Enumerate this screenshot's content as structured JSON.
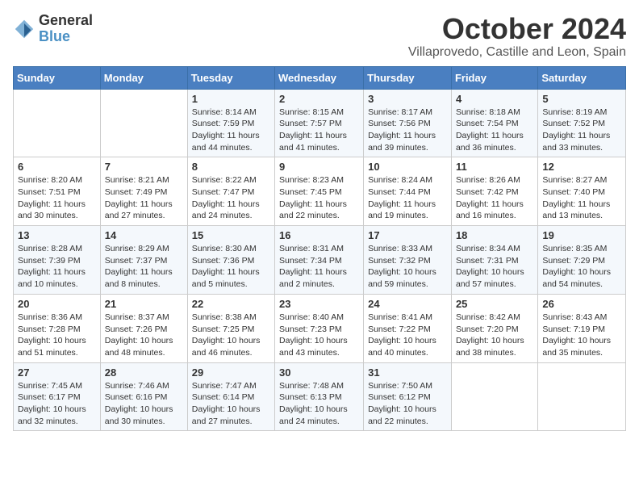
{
  "logo": {
    "general": "General",
    "blue": "Blue"
  },
  "title": "October 2024",
  "location": "Villaprovedo, Castille and Leon, Spain",
  "days_of_week": [
    "Sunday",
    "Monday",
    "Tuesday",
    "Wednesday",
    "Thursday",
    "Friday",
    "Saturday"
  ],
  "weeks": [
    [
      {
        "day": "",
        "info": ""
      },
      {
        "day": "",
        "info": ""
      },
      {
        "day": "1",
        "info": "Sunrise: 8:14 AM\nSunset: 7:59 PM\nDaylight: 11 hours and 44 minutes."
      },
      {
        "day": "2",
        "info": "Sunrise: 8:15 AM\nSunset: 7:57 PM\nDaylight: 11 hours and 41 minutes."
      },
      {
        "day": "3",
        "info": "Sunrise: 8:17 AM\nSunset: 7:56 PM\nDaylight: 11 hours and 39 minutes."
      },
      {
        "day": "4",
        "info": "Sunrise: 8:18 AM\nSunset: 7:54 PM\nDaylight: 11 hours and 36 minutes."
      },
      {
        "day": "5",
        "info": "Sunrise: 8:19 AM\nSunset: 7:52 PM\nDaylight: 11 hours and 33 minutes."
      }
    ],
    [
      {
        "day": "6",
        "info": "Sunrise: 8:20 AM\nSunset: 7:51 PM\nDaylight: 11 hours and 30 minutes."
      },
      {
        "day": "7",
        "info": "Sunrise: 8:21 AM\nSunset: 7:49 PM\nDaylight: 11 hours and 27 minutes."
      },
      {
        "day": "8",
        "info": "Sunrise: 8:22 AM\nSunset: 7:47 PM\nDaylight: 11 hours and 24 minutes."
      },
      {
        "day": "9",
        "info": "Sunrise: 8:23 AM\nSunset: 7:45 PM\nDaylight: 11 hours and 22 minutes."
      },
      {
        "day": "10",
        "info": "Sunrise: 8:24 AM\nSunset: 7:44 PM\nDaylight: 11 hours and 19 minutes."
      },
      {
        "day": "11",
        "info": "Sunrise: 8:26 AM\nSunset: 7:42 PM\nDaylight: 11 hours and 16 minutes."
      },
      {
        "day": "12",
        "info": "Sunrise: 8:27 AM\nSunset: 7:40 PM\nDaylight: 11 hours and 13 minutes."
      }
    ],
    [
      {
        "day": "13",
        "info": "Sunrise: 8:28 AM\nSunset: 7:39 PM\nDaylight: 11 hours and 10 minutes."
      },
      {
        "day": "14",
        "info": "Sunrise: 8:29 AM\nSunset: 7:37 PM\nDaylight: 11 hours and 8 minutes."
      },
      {
        "day": "15",
        "info": "Sunrise: 8:30 AM\nSunset: 7:36 PM\nDaylight: 11 hours and 5 minutes."
      },
      {
        "day": "16",
        "info": "Sunrise: 8:31 AM\nSunset: 7:34 PM\nDaylight: 11 hours and 2 minutes."
      },
      {
        "day": "17",
        "info": "Sunrise: 8:33 AM\nSunset: 7:32 PM\nDaylight: 10 hours and 59 minutes."
      },
      {
        "day": "18",
        "info": "Sunrise: 8:34 AM\nSunset: 7:31 PM\nDaylight: 10 hours and 57 minutes."
      },
      {
        "day": "19",
        "info": "Sunrise: 8:35 AM\nSunset: 7:29 PM\nDaylight: 10 hours and 54 minutes."
      }
    ],
    [
      {
        "day": "20",
        "info": "Sunrise: 8:36 AM\nSunset: 7:28 PM\nDaylight: 10 hours and 51 minutes."
      },
      {
        "day": "21",
        "info": "Sunrise: 8:37 AM\nSunset: 7:26 PM\nDaylight: 10 hours and 48 minutes."
      },
      {
        "day": "22",
        "info": "Sunrise: 8:38 AM\nSunset: 7:25 PM\nDaylight: 10 hours and 46 minutes."
      },
      {
        "day": "23",
        "info": "Sunrise: 8:40 AM\nSunset: 7:23 PM\nDaylight: 10 hours and 43 minutes."
      },
      {
        "day": "24",
        "info": "Sunrise: 8:41 AM\nSunset: 7:22 PM\nDaylight: 10 hours and 40 minutes."
      },
      {
        "day": "25",
        "info": "Sunrise: 8:42 AM\nSunset: 7:20 PM\nDaylight: 10 hours and 38 minutes."
      },
      {
        "day": "26",
        "info": "Sunrise: 8:43 AM\nSunset: 7:19 PM\nDaylight: 10 hours and 35 minutes."
      }
    ],
    [
      {
        "day": "27",
        "info": "Sunrise: 7:45 AM\nSunset: 6:17 PM\nDaylight: 10 hours and 32 minutes."
      },
      {
        "day": "28",
        "info": "Sunrise: 7:46 AM\nSunset: 6:16 PM\nDaylight: 10 hours and 30 minutes."
      },
      {
        "day": "29",
        "info": "Sunrise: 7:47 AM\nSunset: 6:14 PM\nDaylight: 10 hours and 27 minutes."
      },
      {
        "day": "30",
        "info": "Sunrise: 7:48 AM\nSunset: 6:13 PM\nDaylight: 10 hours and 24 minutes."
      },
      {
        "day": "31",
        "info": "Sunrise: 7:50 AM\nSunset: 6:12 PM\nDaylight: 10 hours and 22 minutes."
      },
      {
        "day": "",
        "info": ""
      },
      {
        "day": "",
        "info": ""
      }
    ]
  ]
}
